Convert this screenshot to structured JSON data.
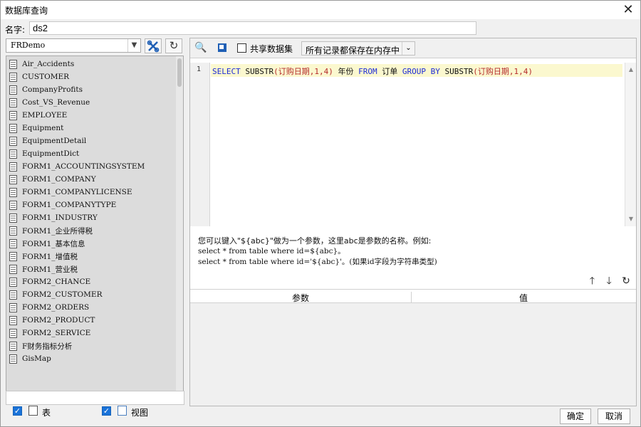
{
  "window": {
    "title": "数据库查询",
    "close_glyph": "✕"
  },
  "name_field": {
    "label": "名字:",
    "value": "ds2"
  },
  "left": {
    "connection": "FRDemo",
    "tables": [
      "Air_Accidents",
      "CUSTOMER",
      "CompanyProfits",
      "Cost_VS_Revenue",
      "EMPLOYEE",
      "Equipment",
      "EquipmentDetail",
      "EquipmentDict",
      "FORM1_ACCOUNTINGSYSTEM",
      "FORM1_COMPANY",
      "FORM1_COMPANYLICENSE",
      "FORM1_COMPANYTYPE",
      "FORM1_INDUSTRY",
      "FORM1_企业所得税",
      "FORM1_基本信息",
      "FORM1_增值税",
      "FORM1_营业税",
      "FORM2_CHANCE",
      "FORM2_CUSTOMER",
      "FORM2_ORDERS",
      "FORM2_PRODUCT",
      "FORM2_SERVICE",
      "F财务指标分析",
      "GisMap"
    ],
    "filter_table_label": "表",
    "filter_view_label": "视图",
    "check_glyph": "✓"
  },
  "right": {
    "share_label": "共享数据集",
    "mode_value": "所有记录都保存在内存中",
    "line_number": "1",
    "sql": {
      "kw_select": "SELECT",
      "fn1": "SUBSTR",
      "args1": "(订购日期,1,4)",
      "alias": "年份",
      "kw_from": "FROM",
      "table": "订单",
      "kw_group": "GROUP BY",
      "fn2": "SUBSTR",
      "args2": "(订购日期,1,4)"
    },
    "hint_line1": "您可以键入\"${abc}\"做为一个参数，这里abc是参数的名称。例如:",
    "hint_line2": "select * from table where id=${abc}。",
    "hint_line3": "select * from table where id='${abc}'。(如果id字段为字符串类型)",
    "col_param": "参数",
    "col_value": "值"
  },
  "footer": {
    "ok": "确定",
    "cancel": "取消"
  }
}
